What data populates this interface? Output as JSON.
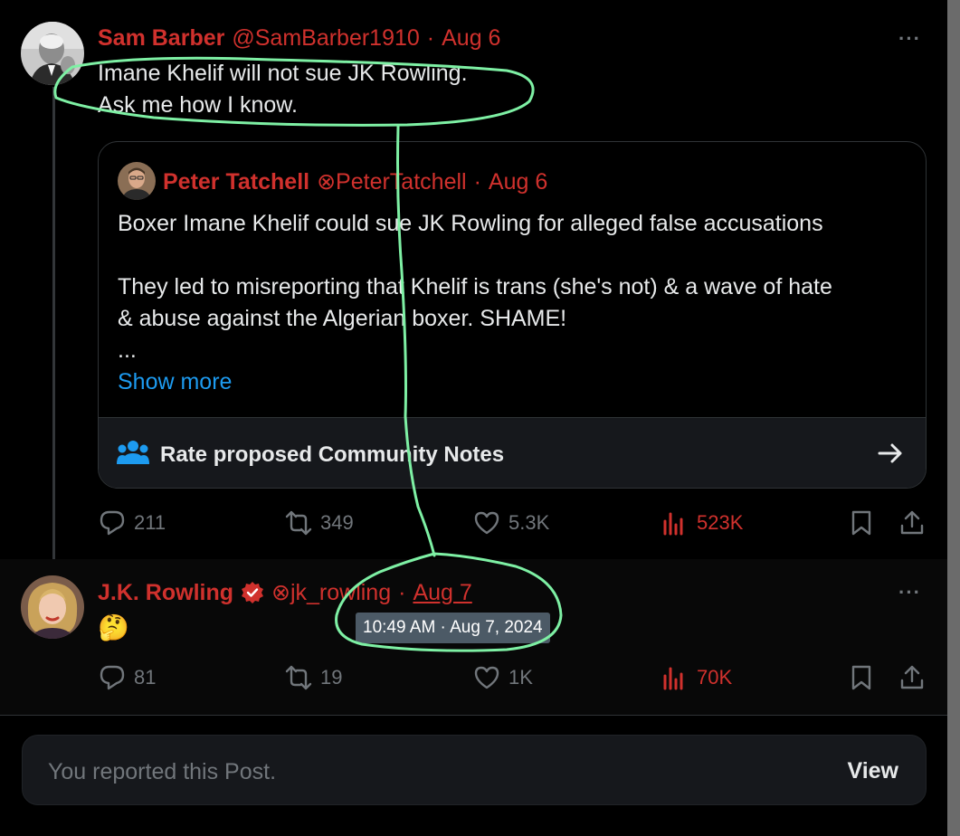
{
  "colors": {
    "name_red": "#d0312d",
    "link_blue": "#1d9bf0",
    "muted": "#71767b",
    "annotation_green": "#7ef0a4"
  },
  "tweet1": {
    "author_name": "Sam Barber",
    "handle": "@SamBarber1910",
    "separator": "·",
    "date": "Aug 6",
    "more": "···",
    "line1": "Imane Khelif will not sue JK Rowling.",
    "line2": "Ask me how I know.",
    "quote": {
      "author_name": "Peter Tatchell",
      "handle": "⊗PeterTatchell",
      "separator": "·",
      "date": "Aug 6",
      "line1": "Boxer Imane Khelif could sue JK Rowling for alleged false accusations",
      "line2": "They led to misreporting that Khelif is trans (she's not) & a wave of hate",
      "line3": "& abuse against the Algerian boxer. SHAME!",
      "ellipsis": "...",
      "show_more": "Show more",
      "notes_label": "Rate proposed Community Notes"
    },
    "stats": {
      "replies": "211",
      "reposts": "349",
      "likes": "5.3K",
      "views": "523K"
    }
  },
  "tweet2": {
    "author_name": "J.K. Rowling",
    "handle": "⊗jk_rowling",
    "separator": "·",
    "date": "Aug 7",
    "more": "···",
    "emoji": "🤔",
    "tooltip": "10:49 AM · Aug 7, 2024",
    "stats": {
      "replies": "81",
      "reposts": "19",
      "likes": "1K",
      "views": "70K"
    }
  },
  "report_banner": {
    "text": "You reported this Post.",
    "button": "View"
  }
}
